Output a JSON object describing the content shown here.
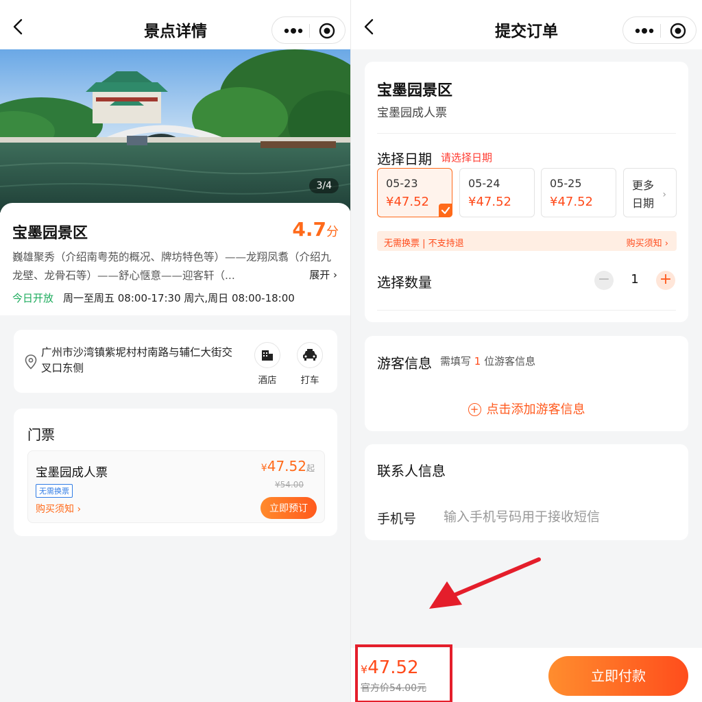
{
  "colors": {
    "accent": "#ff5a1e",
    "open_green": "#1cab5c",
    "tag_blue": "#2f7be5",
    "highlight_red": "#e41e2b"
  },
  "left": {
    "nav": {
      "title": "景点详情"
    },
    "gallery": {
      "pager": "3/4"
    },
    "info": {
      "name": "宝墨园景区",
      "rating": "4.7",
      "rating_unit": "分",
      "description": "巍雄聚秀（介绍南粤苑的概况、牌坊特色等）——龙翔凤翥（介绍九龙壁、龙骨石等）——舒心惬意——迎客轩（...",
      "expand_label": "展开 ›",
      "open_status": "今日开放",
      "open_hours": "周一至周五 08:00-17:30 周六,周日 08:00-18:00"
    },
    "address": {
      "text": "广州市沙湾镇紫坭村村南路与辅仁大街交叉口东侧",
      "hotel_label": "酒店",
      "taxi_label": "打车"
    },
    "tickets": {
      "title": "门票",
      "item": {
        "name": "宝墨园成人票",
        "tag": "无需换票",
        "notice": "购买须知 ›",
        "currency": "¥",
        "price": "47.52",
        "price_suffix": "起",
        "original_price": "¥54.00",
        "book_label": "立即预订"
      }
    }
  },
  "right": {
    "nav": {
      "title": "提交订单"
    },
    "order": {
      "name": "宝墨园景区",
      "ticket": "宝墨园成人票",
      "date_label": "选择日期",
      "date_hint": "请选择日期",
      "dates": [
        {
          "date": "05-23",
          "price": "¥47.52",
          "selected": true
        },
        {
          "date": "05-24",
          "price": "¥47.52",
          "selected": false
        },
        {
          "date": "05-25",
          "price": "¥47.52",
          "selected": false
        }
      ],
      "more_dates": "更多日期",
      "notice_left": "无需换票 | 不支持退",
      "notice_right": "购买须知 ›",
      "qty_label": "选择数量",
      "qty_minus": "−",
      "qty_value": "1",
      "qty_plus": "+"
    },
    "guest": {
      "title": "游客信息",
      "need_prefix": "需填写",
      "need_count": "1",
      "need_suffix": "位游客信息",
      "add_icon": "+",
      "add_label": "点击添加游客信息"
    },
    "contact": {
      "title": "联系人信息",
      "phone_label": "手机号",
      "phone_placeholder": "输入手机号码用于接收短信",
      "phone_value": ""
    },
    "bottom": {
      "currency": "¥",
      "price": "47.52",
      "original_price": "官方价54.00元",
      "pay_label": "立即付款"
    }
  }
}
